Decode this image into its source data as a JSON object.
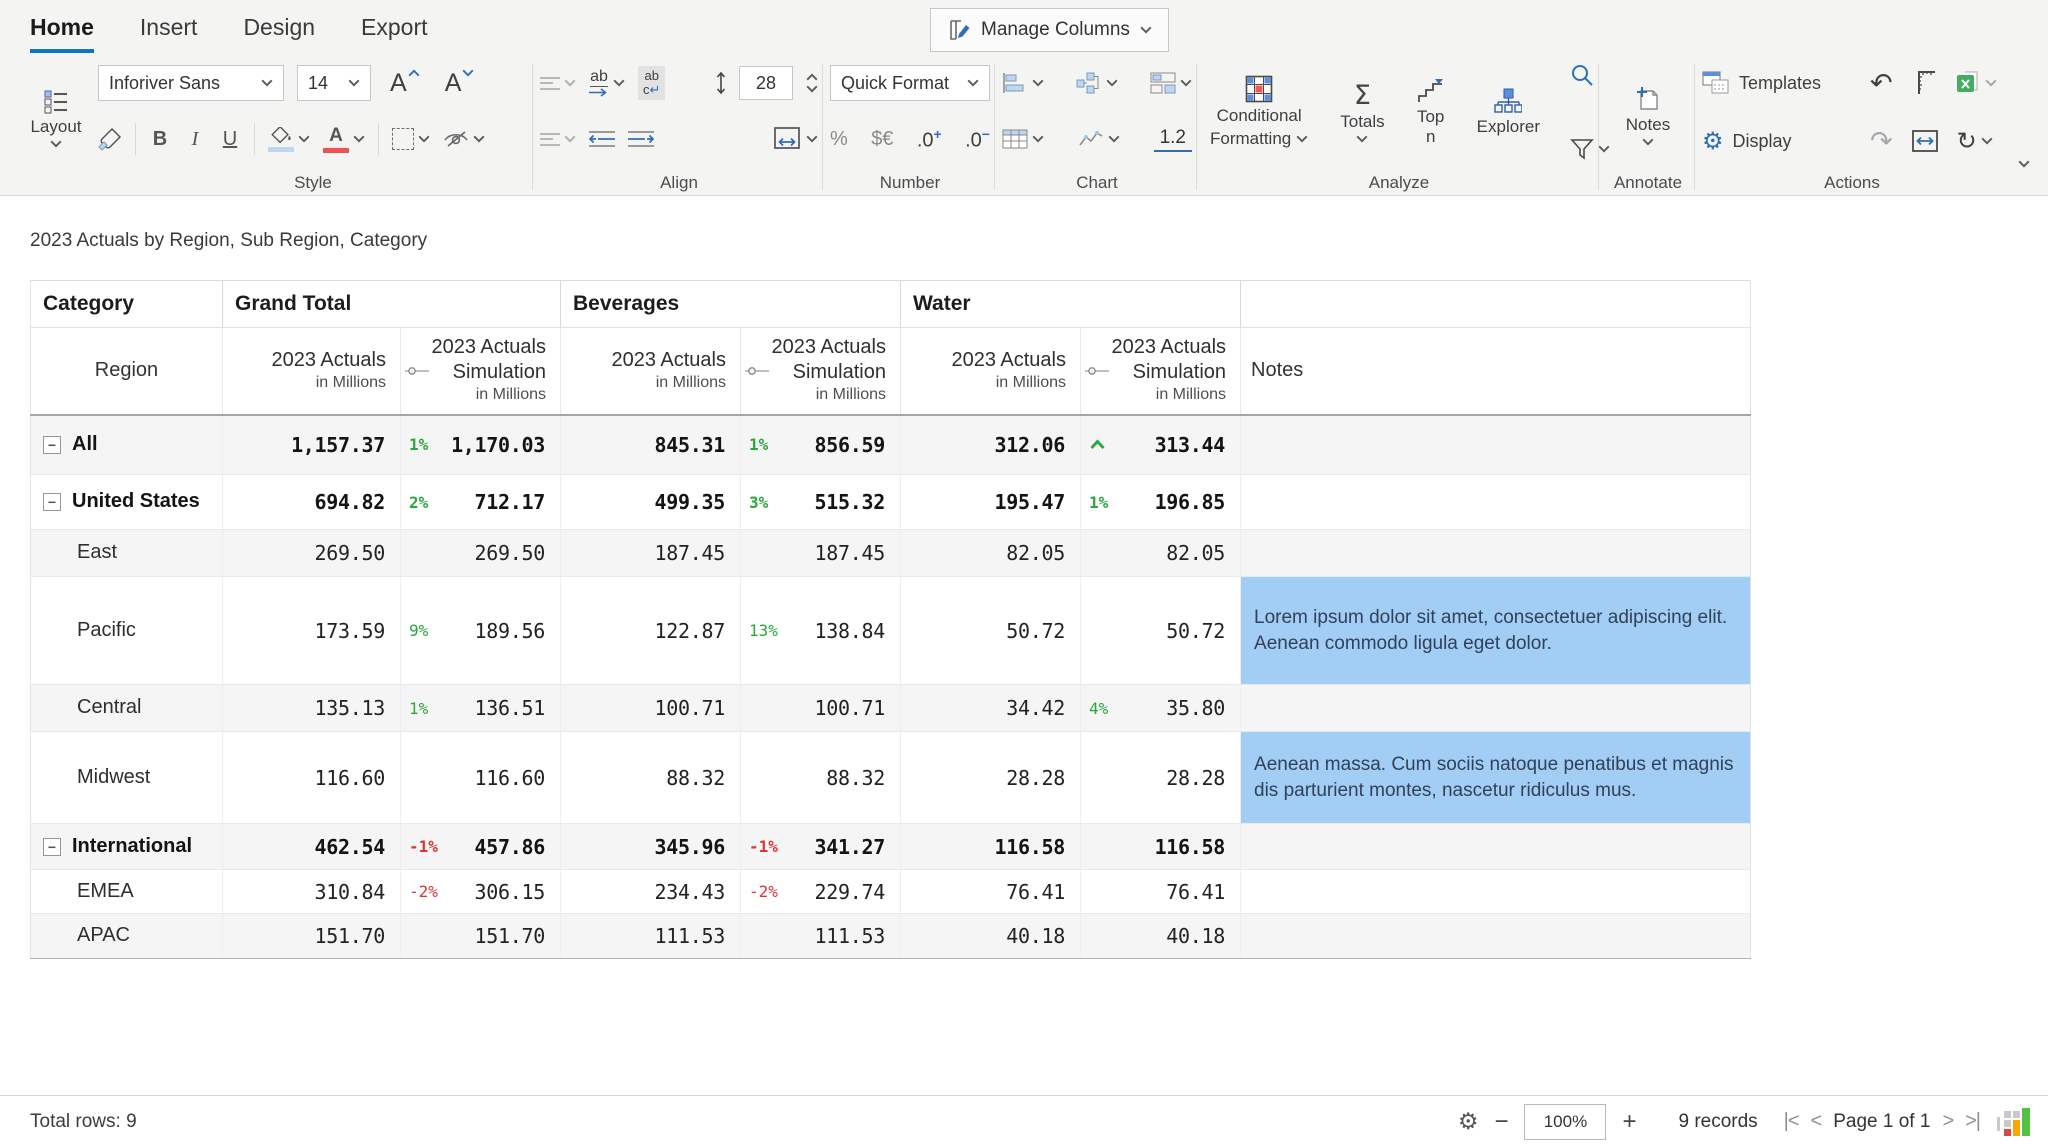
{
  "colors": {
    "accent": "#1273c4",
    "positive": "#2aa63c",
    "negative": "#df3538",
    "note_highlight": "#a2cdf4",
    "excel_green": "#44ad63"
  },
  "ribbon": {
    "tabs": [
      {
        "label": "Home",
        "active": true
      },
      {
        "label": "Insert",
        "active": false
      },
      {
        "label": "Design",
        "active": false
      },
      {
        "label": "Export",
        "active": false
      }
    ],
    "manage_columns_label": "Manage Columns",
    "layout_label": "Layout",
    "group_labels": {
      "style": "Style",
      "align": "Align",
      "number": "Number",
      "chart": "Chart",
      "analyze": "Analyze",
      "annotate": "Annotate",
      "actions": "Actions"
    },
    "style": {
      "font_name": "Inforiver Sans",
      "font_size": "14",
      "bold": "B",
      "italic": "I",
      "underline": "U"
    },
    "align": {
      "row_height": "28",
      "overflow_label": "ab",
      "wrap_line1": "ab",
      "wrap_line2": "c",
      "wrap_return": "↵"
    },
    "number": {
      "quick_format": "Quick Format",
      "percent": "%",
      "currency": "$€",
      "decimal_inc_base": ".0",
      "decimal_inc_sup": "+",
      "decimal_dec_base": ".0",
      "decimal_dec_sup": "−"
    },
    "chart": {
      "decimal_label": "1.2"
    },
    "analyze": {
      "conditional_line1": "Conditional",
      "conditional_line2": "Formatting",
      "totals": "Totals",
      "top_n": "Top n",
      "explorer": "Explorer"
    },
    "annotate": {
      "notes": "Notes"
    },
    "actions": {
      "templates": "Templates",
      "display": "Display"
    }
  },
  "table": {
    "title": "2023 Actuals by Region, Sub Region, Category",
    "corner_header": "Category",
    "region_header": "Region",
    "notes_header": "Notes",
    "groups": [
      {
        "label": "Grand Total"
      },
      {
        "label": "Beverages"
      },
      {
        "label": "Water"
      }
    ],
    "measure": {
      "line1": "2023 Actuals",
      "sub": "in Millions"
    },
    "sim_measure": {
      "line1": "2023 Actuals",
      "line2": "Simulation",
      "sub": "in Millions"
    },
    "rows": [
      {
        "name": "All",
        "level": 1,
        "bold": true,
        "expand": true,
        "note": "",
        "note_highlight": false,
        "cells": [
          {
            "v": "1,157.37"
          },
          {
            "pct": "1%",
            "v": "1,170.03"
          },
          {
            "v": "845.31"
          },
          {
            "pct": "1%",
            "v": "856.59"
          },
          {
            "v": "312.06"
          },
          {
            "marker": "up",
            "v": "313.44"
          }
        ]
      },
      {
        "name": "United States",
        "level": 1,
        "bold": true,
        "expand": true,
        "note": "",
        "note_highlight": false,
        "cells": [
          {
            "v": "694.82"
          },
          {
            "pct": "2%",
            "v": "712.17"
          },
          {
            "v": "499.35"
          },
          {
            "pct": "3%",
            "v": "515.32"
          },
          {
            "v": "195.47"
          },
          {
            "pct": "1%",
            "v": "196.85"
          }
        ]
      },
      {
        "name": "East",
        "level": 2,
        "bold": false,
        "expand": false,
        "note": "",
        "note_highlight": false,
        "cells": [
          {
            "v": "269.50"
          },
          {
            "v": "269.50"
          },
          {
            "v": "187.45"
          },
          {
            "v": "187.45"
          },
          {
            "v": "82.05"
          },
          {
            "v": "82.05"
          }
        ]
      },
      {
        "name": "Pacific",
        "level": 2,
        "bold": false,
        "expand": false,
        "note_highlight": true,
        "note": "Lorem ipsum dolor sit amet, consectetuer adipiscing elit. Aenean commodo ligula eget dolor.",
        "cells": [
          {
            "v": "173.59"
          },
          {
            "pct": "9%",
            "v": "189.56"
          },
          {
            "v": "122.87"
          },
          {
            "pct": "13%",
            "v": "138.84"
          },
          {
            "v": "50.72"
          },
          {
            "v": "50.72"
          }
        ]
      },
      {
        "name": "Central",
        "level": 2,
        "bold": false,
        "expand": false,
        "note": "",
        "note_highlight": false,
        "cells": [
          {
            "v": "135.13"
          },
          {
            "pct": "1%",
            "v": "136.51"
          },
          {
            "v": "100.71"
          },
          {
            "v": "100.71"
          },
          {
            "v": "34.42"
          },
          {
            "pct": "4%",
            "v": "35.80"
          }
        ]
      },
      {
        "name": "Midwest",
        "level": 2,
        "bold": false,
        "expand": false,
        "note_highlight": true,
        "note": "Aenean massa. Cum sociis natoque penatibus et magnis dis parturient montes, nascetur ridiculus mus.",
        "cells": [
          {
            "v": "116.60"
          },
          {
            "v": "116.60"
          },
          {
            "v": "88.32"
          },
          {
            "v": "88.32"
          },
          {
            "v": "28.28"
          },
          {
            "v": "28.28"
          }
        ]
      },
      {
        "name": "International",
        "level": 1,
        "bold": true,
        "expand": true,
        "note": "",
        "note_highlight": false,
        "cells": [
          {
            "v": "462.54"
          },
          {
            "pct": "-1%",
            "v": "457.86"
          },
          {
            "v": "345.96"
          },
          {
            "pct": "-1%",
            "v": "341.27"
          },
          {
            "v": "116.58"
          },
          {
            "v": "116.58"
          }
        ]
      },
      {
        "name": "EMEA",
        "level": 2,
        "bold": false,
        "expand": false,
        "note": "",
        "note_highlight": false,
        "cells": [
          {
            "v": "310.84"
          },
          {
            "pct": "-2%",
            "v": "306.15"
          },
          {
            "v": "234.43"
          },
          {
            "pct": "-2%",
            "v": "229.74"
          },
          {
            "v": "76.41"
          },
          {
            "v": "76.41"
          }
        ]
      },
      {
        "name": "APAC",
        "level": 2,
        "bold": false,
        "expand": false,
        "note": "",
        "note_highlight": false,
        "cells": [
          {
            "v": "151.70"
          },
          {
            "v": "151.70"
          },
          {
            "v": "111.53"
          },
          {
            "v": "111.53"
          },
          {
            "v": "40.18"
          },
          {
            "v": "40.18"
          }
        ]
      }
    ]
  },
  "status": {
    "total_rows": "Total rows: 9",
    "minus": "−",
    "zoom_value": "100%",
    "plus": "+",
    "records": "9 records",
    "first": "|<",
    "prev": "<",
    "page_label": "Page 1 of 1",
    "next": ">",
    "last": ">|"
  }
}
